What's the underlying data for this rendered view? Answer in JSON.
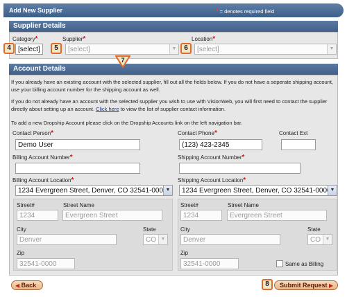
{
  "header": {
    "title": "Add New Supplier",
    "required_star": "*",
    "required_note": "= denotes required field"
  },
  "supplier_details": {
    "heading": "Supplier Details",
    "category_label": "Category",
    "category_value": "[select]",
    "supplier_label": "Supplier",
    "supplier_value": "[select]",
    "location_label": "Location",
    "location_value": "[select]"
  },
  "account_details": {
    "heading": "Account Details",
    "info_1": "If you already have an existing account with the selected supplier, fill out all the fields below. If you do not have a seperate shipping account, use your billing account number for the shipping account as well.",
    "info_2_pre": "If you do not already have an account with the selected supplier you wish to use with VisionWeb, you will first need to contact the supplier directly about setting up an account.",
    "info_2_link": "Click here",
    "info_2_post": "to view the list of supplier contact information.",
    "info_3": "To add a new Dropship Account please click on the Dropship Accounts link on the left navigation bar.",
    "contact_person_label": "Contact Person",
    "contact_person_value": "Demo User",
    "contact_phone_label": "Contact Phone",
    "contact_phone_value": "(123) 423-2345",
    "contact_ext_label": "Contact Ext",
    "contact_ext_value": "",
    "billing_account_label": "Billing Account Number",
    "billing_account_value": "",
    "shipping_account_label": "Shipping Account Number",
    "shipping_account_value": "",
    "billing_location_label": "Billing Account Location",
    "billing_location_value": "1234 Evergreen Street, Denver, CO 32541-0000",
    "shipping_location_label": "Shipping Account Location",
    "shipping_location_value": "1234 Evergreen Street, Denver, CO 32541-0000",
    "billing": {
      "street_no_label": "Street#",
      "street_no_value": "1234",
      "street_name_label": "Street Name",
      "street_name_value": "Evergreen Street",
      "city_label": "City",
      "city_value": "Denver",
      "state_label": "State",
      "state_value": "CO",
      "zip_label": "Zip",
      "zip_value": "32541-0000"
    },
    "shipping": {
      "street_no_label": "Street#",
      "street_no_value": "1234",
      "street_name_label": "Street Name",
      "street_name_value": "Evergreen Street",
      "city_label": "City",
      "city_value": "Denver",
      "state_label": "State",
      "state_value": "CO",
      "zip_label": "Zip",
      "zip_value": "32541-0000",
      "same_as_billing_label": "Same as Billing"
    }
  },
  "buttons": {
    "back_label": "Back",
    "back_arrow": "◀",
    "submit_label": "Submit Request",
    "submit_arrow": "▶"
  },
  "callouts": {
    "c4": "4",
    "c5": "5",
    "c6": "6",
    "c7": "7",
    "c8": "8"
  },
  "colors": {
    "header_blue": "#3c5f8a",
    "required_red": "#d6121d",
    "callout_orange": "#e06a2a",
    "button_fill": "#e9b98b"
  }
}
